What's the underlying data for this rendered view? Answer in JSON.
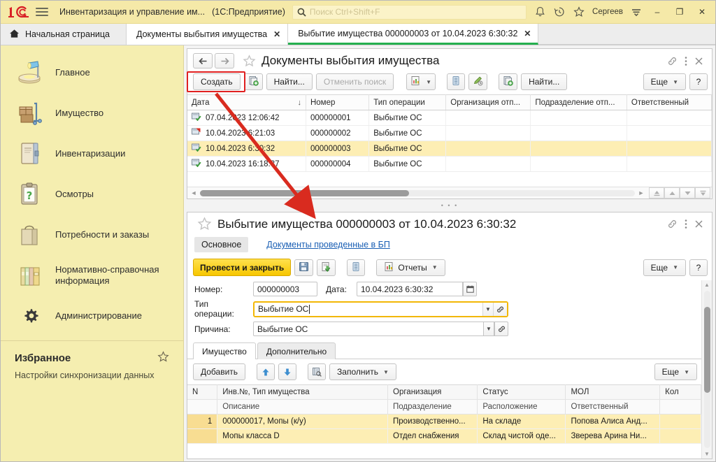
{
  "titlebar": {
    "logo": "1c-logo",
    "menu_icon": "hamburger-menu-icon",
    "app_title": "Инвентаризация и управление им...",
    "edition": "(1С:Предприятие)",
    "search_placeholder": "Поиск Ctrl+Shift+F",
    "search_value": "",
    "notifications_icon": "bell-icon",
    "history_icon": "history-clock-icon",
    "favorites_icon": "star-icon",
    "user": "Сергеев",
    "user_menu_icon": "user-menu-icon",
    "minimize": "–",
    "maximize": "❐",
    "close": "✕"
  },
  "tabs": {
    "home_label": "Начальная страница",
    "home_icon": "home-icon",
    "items": [
      {
        "label": "Документы выбытия имущества",
        "close": "✕",
        "active": false
      },
      {
        "label": "Выбытие имущества 000000003 от 10.04.2023 6:30:32",
        "close": "✕",
        "active": true
      }
    ]
  },
  "sidebar": {
    "items": [
      {
        "label": "Главное",
        "icon": "desk-lamp-icon"
      },
      {
        "label": "Имущество",
        "icon": "boxes-cart-icon"
      },
      {
        "label": "Инвентаризации",
        "icon": "book-icon"
      },
      {
        "label": "Осмотры",
        "icon": "clipboard-question-icon"
      },
      {
        "label": "Потребности и заказы",
        "icon": "shopping-bag-icon"
      },
      {
        "label": "Нормативно-справочная информация",
        "icon": "folders-icon"
      },
      {
        "label": "Администрирование",
        "icon": "gear-icon"
      }
    ],
    "favorites": {
      "title": "Избранное",
      "star_icon": "star-outline-icon",
      "links": [
        "Настройки синхронизации данных"
      ]
    }
  },
  "list_panel": {
    "back_icon": "arrow-left-icon",
    "forward_icon": "arrow-right-icon",
    "star_icon": "star-outline-icon",
    "title": "Документы выбытия имущества",
    "link_icon": "link-icon",
    "more_icon": "kebab-menu-icon",
    "close_icon": "close-icon",
    "toolbar": {
      "create": "Создать",
      "create_from_icon": "copy-green-icon",
      "find": "Найти...",
      "cancel_search": "Отменить поиск",
      "report_icon": "report-icon",
      "list_icon": "list-icon",
      "edit_icon": "pencil-clock-icon",
      "copy_icon": "copy-green-icon",
      "find2": "Найти...",
      "more": "Еще",
      "help": "?"
    },
    "columns": [
      "Дата",
      "Номер",
      "Тип операции",
      "Организация отп...",
      "Подразделение отп...",
      "Ответственный"
    ],
    "sort_column": "Дата",
    "rows": [
      {
        "status_icon": "posted-icon",
        "date": "07.04.2023 12:06:42",
        "number": "000000001",
        "operation": "Выбытие ОС",
        "org": "",
        "dept": "",
        "responsible": "",
        "selected": false
      },
      {
        "status_icon": "deletion-mark-icon",
        "date": "10.04.2023 6:21:03",
        "number": "000000002",
        "operation": "Выбытие ОС",
        "org": "",
        "dept": "",
        "responsible": "",
        "selected": false
      },
      {
        "status_icon": "posted-icon",
        "date": "10.04.2023 6:30:32",
        "number": "000000003",
        "operation": "Выбытие ОС",
        "org": "",
        "dept": "",
        "responsible": "",
        "selected": true
      },
      {
        "status_icon": "posted-icon",
        "date": "10.04.2023 16:18:37",
        "number": "000000004",
        "operation": "Выбытие ОС",
        "org": "",
        "dept": "",
        "responsible": "",
        "selected": false
      }
    ]
  },
  "doc_panel": {
    "star_icon": "star-outline-icon",
    "title": "Выбытие имущества 000000003 от 10.04.2023 6:30:32",
    "link_icon": "link-icon",
    "more_icon": "kebab-menu-icon",
    "close_icon": "close-icon",
    "subtabs": [
      {
        "label": "Основное",
        "active": true,
        "link": false
      },
      {
        "label": "Документы проведенные в БП",
        "active": false,
        "link": true
      }
    ],
    "toolbar": {
      "post_and_close": "Провести и закрыть",
      "save_icon": "floppy-save-icon",
      "post_icon": "post-document-icon",
      "register_icon": "registry-icon",
      "reports": "Отчеты",
      "reports_icon": "report-icon",
      "more": "Еще",
      "help": "?"
    },
    "fields": {
      "number_label": "Номер:",
      "number_value": "000000003",
      "date_label": "Дата:",
      "date_value": "10.04.2023 6:30:32",
      "calendar_icon": "calendar-icon",
      "operation_label": "Тип операции:",
      "operation_value": "Выбытие ОС",
      "reason_label": "Причина:",
      "reason_value": "Выбытие ОС",
      "dropdown_icon": "chevron-down-icon",
      "open_icon": "open-link-icon"
    },
    "tabstrip": [
      {
        "label": "Имущество",
        "active": true
      },
      {
        "label": "Дополнительно",
        "active": false
      }
    ],
    "table_toolbar": {
      "add": "Добавить",
      "move_up_icon": "arrow-up-icon",
      "move_down_icon": "arrow-down-icon",
      "select_icon": "book-select-icon",
      "fill": "Заполнить",
      "more": "Еще"
    },
    "table": {
      "header_row1": [
        "N",
        "Инв.№, Тип имущества",
        "Организация",
        "Статус",
        "МОЛ",
        "Кол"
      ],
      "header_row2": [
        "",
        "Описание",
        "Подразделение",
        "Расположение",
        "Ответственный",
        ""
      ],
      "rows": [
        {
          "n": "1",
          "line1": {
            "inv": "000000017, Мопы (к/у)",
            "org": "Производственно...",
            "status": "На складе",
            "mol": "Попова Алиса Анд...",
            "qty": ""
          },
          "line2": {
            "desc": "Мопы класса D",
            "dept": "Отдел снабжения",
            "location": "Склад чистой оде...",
            "responsible": "Зверева Арина Ни...",
            "qty": ""
          }
        }
      ]
    }
  },
  "annotations": {
    "highlight_target": "Создать",
    "arrow_color": "#d92b1f",
    "box_color": "#e02020"
  }
}
